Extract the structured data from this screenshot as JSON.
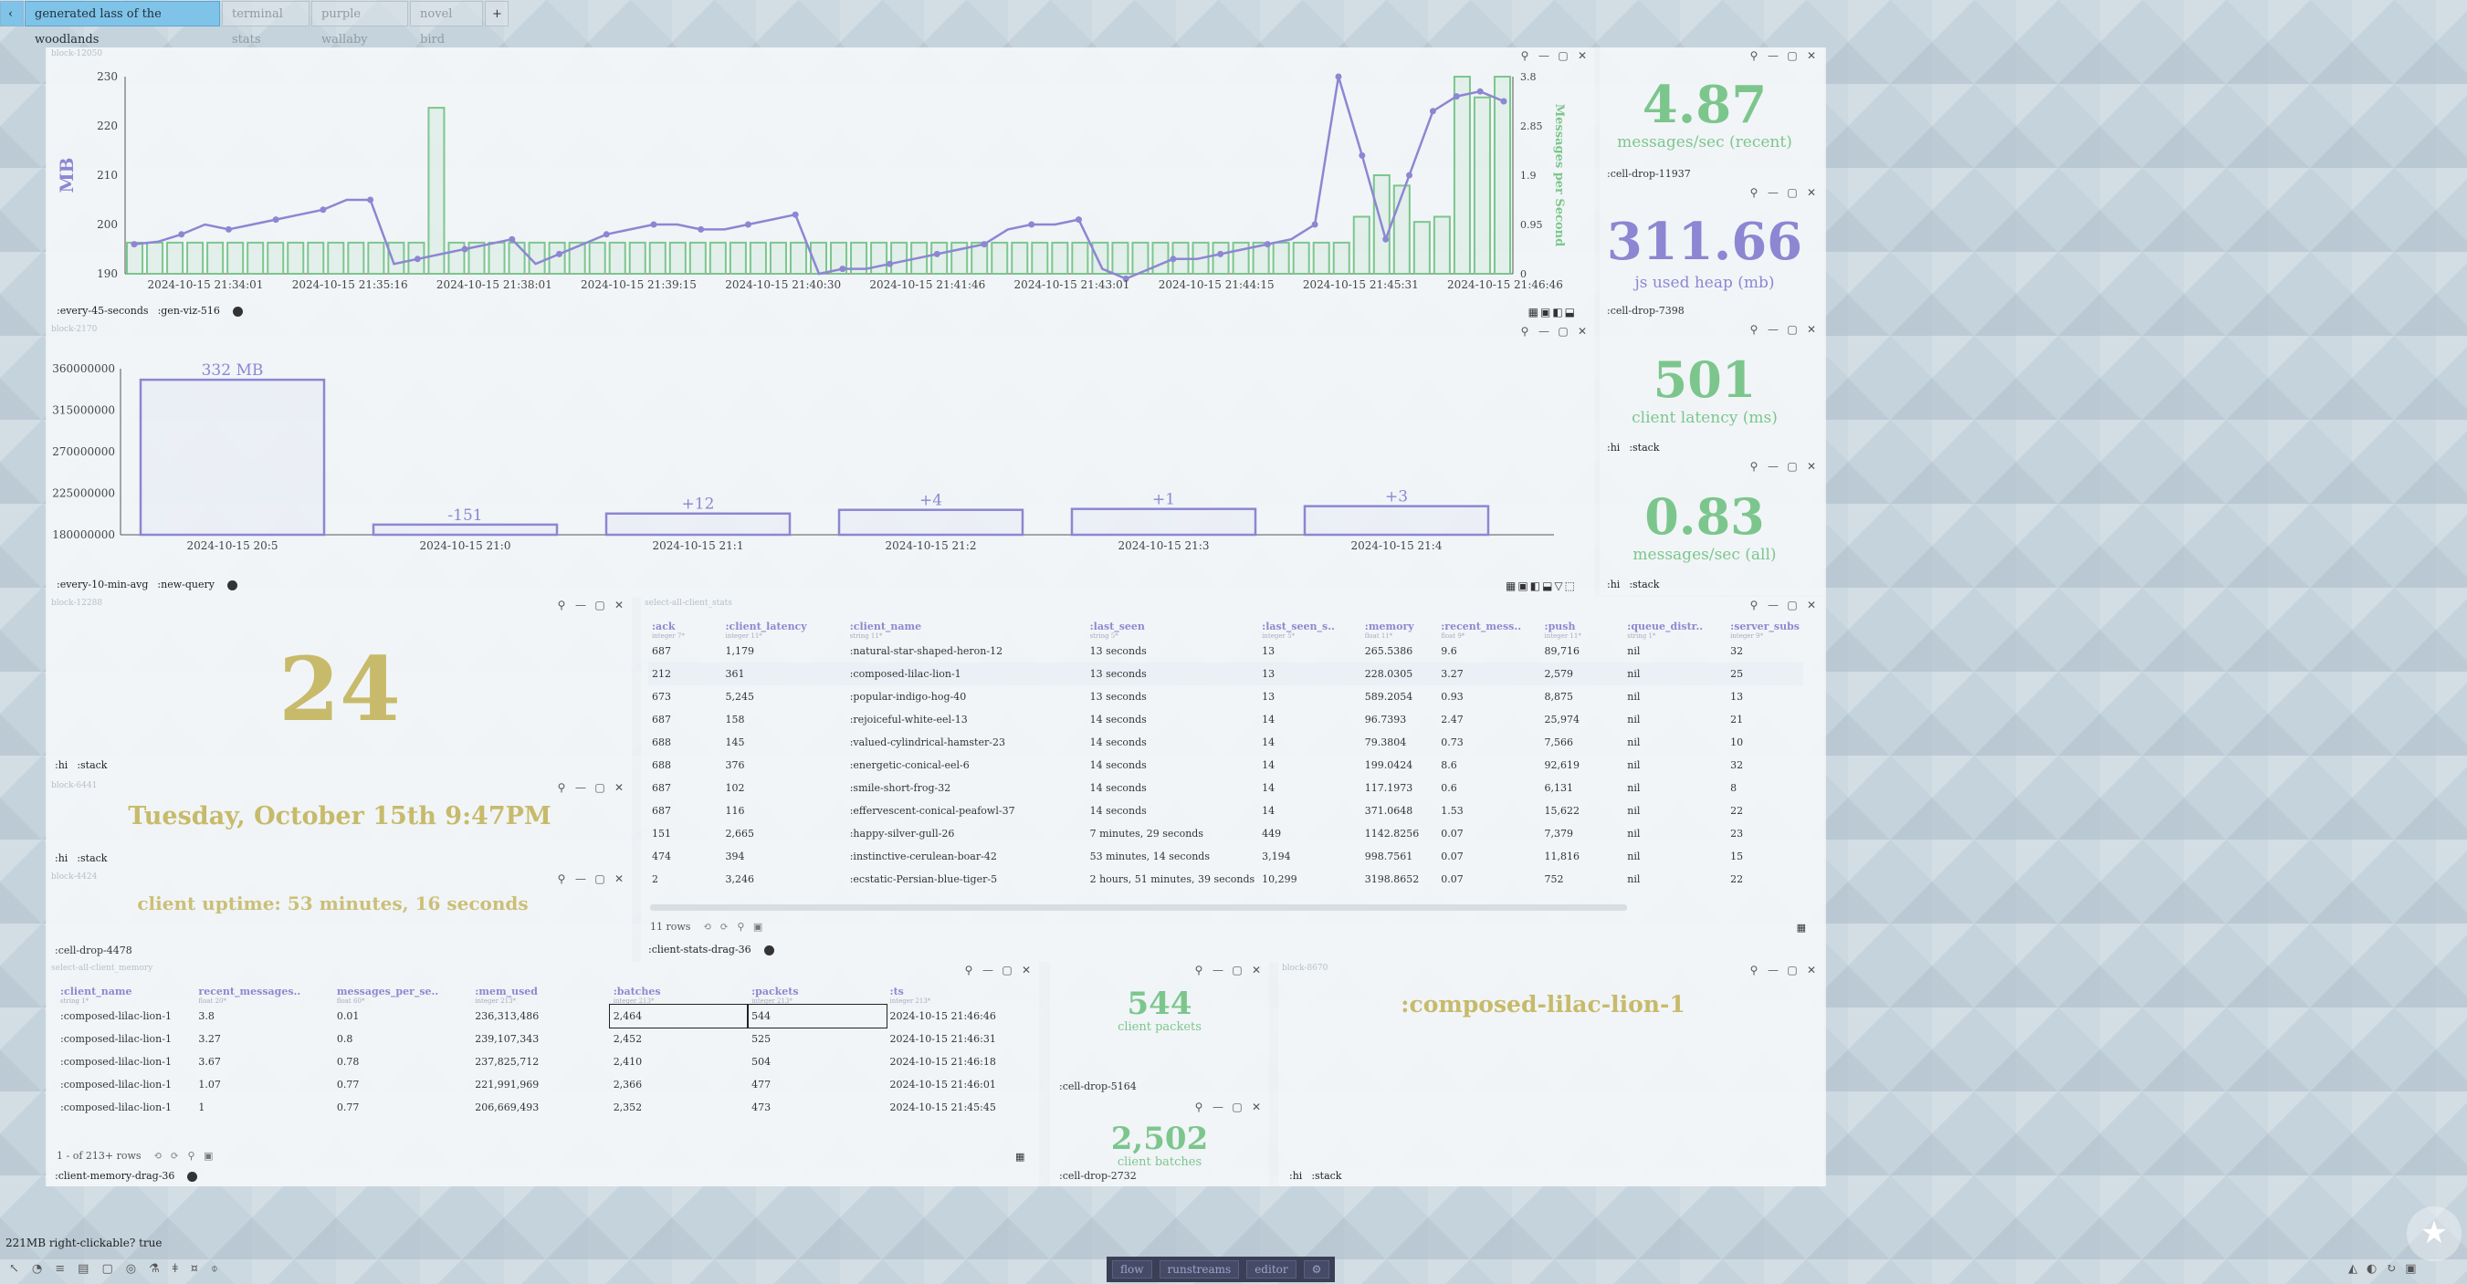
{
  "tabs": {
    "back": "‹",
    "items": [
      "generated lass of the woodlands",
      "terminal stats",
      "purple wallaby",
      "novel bird"
    ],
    "add": "+"
  },
  "block_msgs": {
    "id": "block-12050",
    "left_axis": "MB",
    "right_axis": "Messages per Second",
    "y_ticks": [
      "230",
      "220",
      "210",
      "200",
      "190"
    ],
    "y2_ticks": [
      "3.8",
      "2.85",
      "1.9",
      "0.95",
      "0"
    ],
    "x_ticks": [
      "2024-10-15 21:34:01",
      "2024-10-15 21:35:16",
      "2024-10-15 21:38:01",
      "2024-10-15 21:39:15",
      "2024-10-15 21:40:30",
      "2024-10-15 21:41:46",
      "2024-10-15 21:43:01",
      "2024-10-15 21:44:15",
      "2024-10-15 21:45:31",
      "2024-10-15 21:46:46"
    ],
    "footer": [
      ":every-45-seconds",
      ":gen-viz-516"
    ]
  },
  "chart_data": [
    {
      "type": "line",
      "title": "",
      "ylabel": "MB",
      "ylim": [
        190,
        230
      ],
      "x": [
        "2024-10-15 21:34:01",
        "2024-10-15 21:35:16",
        "2024-10-15 21:38:01",
        "2024-10-15 21:39:15",
        "2024-10-15 21:40:30",
        "2024-10-15 21:41:46",
        "2024-10-15 21:43:01",
        "2024-10-15 21:44:15",
        "2024-10-15 21:45:31",
        "2024-10-15 21:46:46"
      ],
      "series": [
        {
          "name": "",
          "values": [
            196,
            196.5,
            198,
            200,
            199,
            200,
            201,
            202,
            203,
            205,
            205,
            192,
            193,
            194,
            195,
            196,
            197,
            192,
            194,
            196,
            198,
            199,
            200,
            200,
            199,
            199,
            200,
            201,
            202,
            190,
            191,
            191,
            192,
            193,
            194,
            195,
            196,
            199,
            200,
            200,
            201,
            191,
            189,
            191,
            193,
            193,
            194,
            195,
            196,
            197,
            200,
            230,
            214,
            197,
            210,
            223,
            226,
            227,
            225
          ]
        }
      ]
    },
    {
      "type": "bar",
      "ylabel": "Messages per Second",
      "ylim": [
        0,
        3.8
      ],
      "series": [
        {
          "name": "",
          "values": [
            0.6,
            0.6,
            0.6,
            0.6,
            0.6,
            0.6,
            0.6,
            0.6,
            0.6,
            0.6,
            0.6,
            0.6,
            0.6,
            0.6,
            0.6,
            3.2,
            0.6,
            0.6,
            0.6,
            0.6,
            0.6,
            0.6,
            0.6,
            0.6,
            0.6,
            0.6,
            0.6,
            0.6,
            0.6,
            0.6,
            0.6,
            0.6,
            0.6,
            0.6,
            0.6,
            0.6,
            0.6,
            0.6,
            0.6,
            0.6,
            0.6,
            0.6,
            0.6,
            0.6,
            0.6,
            0.6,
            0.6,
            0.6,
            0.6,
            0.6,
            0.6,
            0.6,
            0.6,
            0.6,
            0.6,
            0.6,
            0.6,
            0.6,
            0.6,
            0.6,
            0.6,
            1.1,
            1.9,
            1.7,
            1.0,
            1.1,
            3.8,
            3.4,
            3.8
          ]
        }
      ]
    },
    {
      "type": "bar",
      "title": "",
      "ylim": [
        180000000,
        360000000
      ],
      "y_ticks": [
        "360000000",
        "315000000",
        "270000000",
        "225000000",
        "180000000"
      ],
      "categories": [
        "2024-10-15 20:5",
        "2024-10-15 21:0",
        "2024-10-15 21:1",
        "2024-10-15 21:2",
        "2024-10-15 21:3",
        "2024-10-15 21:4"
      ],
      "values": [
        348000000,
        191000000,
        203000000,
        207000000,
        208000000,
        211000000
      ],
      "labels": [
        "332 MB",
        "-151",
        "+12",
        "+4",
        "+1",
        "+3"
      ]
    }
  ],
  "block_mem": {
    "id": "block-2170",
    "footer": [
      ":every-10-min-avg",
      ":new-query"
    ]
  },
  "stats": {
    "s1": {
      "value": "4.87",
      "label": "messages/sec (recent)",
      "footer": ":cell-drop-11937"
    },
    "s2": {
      "value": "311.66",
      "label": "js used heap (mb)",
      "footer": ":cell-drop-7398"
    },
    "s3": {
      "value": "501",
      "label": "client latency (ms)",
      "footer": [
        ":hi",
        ":stack"
      ]
    },
    "s4": {
      "value": "0.83",
      "label": "messages/sec (all)",
      "footer": [
        ":hi",
        ":stack"
      ]
    }
  },
  "num_block": {
    "id": "block-12288",
    "value": "24",
    "footer": [
      ":hi",
      ":stack"
    ]
  },
  "date_block": {
    "id": "block-6441",
    "value": "Tuesday, October 15th 9:47PM",
    "footer": [
      ":hi",
      ":stack"
    ]
  },
  "uptime_block": {
    "id": "block-4424",
    "value": "client uptime: 53 minutes, 16 seconds",
    "footer": ":cell-drop-4478"
  },
  "client_stats": {
    "id": "select-all-client_stats",
    "columns": [
      {
        "name": ":ack",
        "type": "integer",
        "count": "7*"
      },
      {
        "name": ":client_latency",
        "type": "integer",
        "count": "11*"
      },
      {
        "name": ":client_name",
        "type": "string",
        "count": "11*"
      },
      {
        "name": ":last_seen",
        "type": "string",
        "count": "5*"
      },
      {
        "name": ":last_seen_s..",
        "type": "integer",
        "count": "5*"
      },
      {
        "name": ":memory",
        "type": "float",
        "count": "11*"
      },
      {
        "name": ":recent_mess..",
        "type": "float",
        "count": "9*"
      },
      {
        "name": ":push",
        "type": "integer",
        "count": "11*"
      },
      {
        "name": ":queue_distr..",
        "type": "string",
        "count": "1*"
      },
      {
        "name": ":server_subs",
        "type": "integer",
        "count": "9*"
      }
    ],
    "rows": [
      [
        "687",
        "1,179",
        ":natural-star-shaped-heron-12",
        "13 seconds",
        "13",
        "265.5386",
        "9.6",
        "89,716",
        "nil",
        "32"
      ],
      [
        "212",
        "361",
        ":composed-lilac-lion-1",
        "13 seconds",
        "13",
        "228.0305",
        "3.27",
        "2,579",
        "nil",
        "25"
      ],
      [
        "673",
        "5,245",
        ":popular-indigo-hog-40",
        "13 seconds",
        "13",
        "589.2054",
        "0.93",
        "8,875",
        "nil",
        "13"
      ],
      [
        "687",
        "158",
        ":rejoiceful-white-eel-13",
        "14 seconds",
        "14",
        "96.7393",
        "2.47",
        "25,974",
        "nil",
        "21"
      ],
      [
        "688",
        "145",
        ":valued-cylindrical-hamster-23",
        "14 seconds",
        "14",
        "79.3804",
        "0.73",
        "7,566",
        "nil",
        "10"
      ],
      [
        "688",
        "376",
        ":energetic-conical-eel-6",
        "14 seconds",
        "14",
        "199.0424",
        "8.6",
        "92,619",
        "nil",
        "32"
      ],
      [
        "687",
        "102",
        ":smile-short-frog-32",
        "14 seconds",
        "14",
        "117.1973",
        "0.6",
        "6,131",
        "nil",
        "8"
      ],
      [
        "687",
        "116",
        ":effervescent-conical-peafowl-37",
        "14 seconds",
        "14",
        "371.0648",
        "1.53",
        "15,622",
        "nil",
        "22"
      ],
      [
        "151",
        "2,665",
        ":happy-silver-gull-26",
        "7 minutes, 29 seconds",
        "449",
        "1142.8256",
        "0.07",
        "7,379",
        "nil",
        "23"
      ],
      [
        "474",
        "394",
        ":instinctive-cerulean-boar-42",
        "53 minutes, 14 seconds",
        "3,194",
        "998.7561",
        "0.07",
        "11,816",
        "nil",
        "15"
      ],
      [
        "2",
        "3,246",
        ":ecstatic-Persian-blue-tiger-5",
        "2 hours, 51 minutes, 39 seconds",
        "10,299",
        "3198.8652",
        "0.07",
        "752",
        "nil",
        "22"
      ]
    ],
    "row_count": "11 rows",
    "footer": ":client-stats-drag-36"
  },
  "client_memory": {
    "id": "select-all-client_memory",
    "columns": [
      {
        "name": ":client_name",
        "type": "string",
        "count": "1*"
      },
      {
        "name": "recent_messages..",
        "type": "float",
        "count": "20*"
      },
      {
        "name": "messages_per_se..",
        "type": "float",
        "count": "60*"
      },
      {
        "name": ":mem_used",
        "type": "integer",
        "count": "213*"
      },
      {
        "name": ":batches",
        "type": "integer",
        "count": "213*"
      },
      {
        "name": ":packets",
        "type": "integer",
        "count": "213*"
      },
      {
        "name": ":ts",
        "type": "integer",
        "count": "213*"
      }
    ],
    "rows": [
      [
        ":composed-lilac-lion-1",
        "3.8",
        "0.01",
        "236,313,486",
        "2,464",
        "544",
        "2024-10-15 21:46:46"
      ],
      [
        ":composed-lilac-lion-1",
        "3.27",
        "0.8",
        "239,107,343",
        "2,452",
        "525",
        "2024-10-15 21:46:31"
      ],
      [
        ":composed-lilac-lion-1",
        "3.67",
        "0.78",
        "237,825,712",
        "2,410",
        "504",
        "2024-10-15 21:46:18"
      ],
      [
        ":composed-lilac-lion-1",
        "1.07",
        "0.77",
        "221,991,969",
        "2,366",
        "477",
        "2024-10-15 21:46:01"
      ],
      [
        ":composed-lilac-lion-1",
        "1",
        "0.77",
        "206,669,493",
        "2,352",
        "473",
        "2024-10-15 21:45:45"
      ]
    ],
    "row_count": "1 - of 213+ rows",
    "footer": ":client-memory-drag-36"
  },
  "packets": {
    "value": "544",
    "label": "client packets",
    "footer": ":cell-drop-5164"
  },
  "batches": {
    "value": "2,502",
    "label": "client batches",
    "footer": ":cell-drop-2732"
  },
  "name_block": {
    "id": "block-8670",
    "value": ":composed-lilac-lion-1",
    "footer": [
      ":hi",
      ":stack"
    ]
  },
  "status": "221MB right-clickable? true",
  "bottom_toolbar": [
    "flow",
    "runstreams",
    "editor"
  ],
  "colors": {
    "green": "#7cc68d",
    "purple": "#8d86d2",
    "gold": "#c7ba6a",
    "tab_active": "#7fc3e8"
  }
}
